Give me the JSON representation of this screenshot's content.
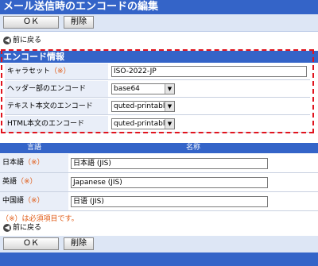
{
  "title": "メール送信時のエンコードの編集",
  "toolbar": {
    "ok_label": "ＯＫ",
    "delete_label": "削除"
  },
  "nav": {
    "back_label": "前に戻る"
  },
  "section": {
    "title": "エンコード情報"
  },
  "form": {
    "required_mark": "（※）",
    "charset": {
      "label": "キャラセット",
      "value": "ISO-2022-JP"
    },
    "header_encoding": {
      "label": "ヘッダー部のエンコード",
      "value": "base64"
    },
    "text_encoding": {
      "label": "テキスト本文のエンコード",
      "value": "quted-printable"
    },
    "html_encoding": {
      "label": "HTML本文のエンコード",
      "value": "quted-printable"
    }
  },
  "table": {
    "headers": {
      "language": "言語",
      "name": "名称"
    },
    "rows": [
      {
        "language": "日本語",
        "value": "日本語 (JIS)"
      },
      {
        "language": "英語",
        "value": "Japanese (JIS)"
      },
      {
        "language": "中国語",
        "value": "日语 (JIS)"
      }
    ]
  },
  "note": "（※）は必須項目です。",
  "colors": {
    "header_blue": "#3464c8",
    "required_orange": "#e05a14",
    "highlight_red": "#e0141e"
  }
}
